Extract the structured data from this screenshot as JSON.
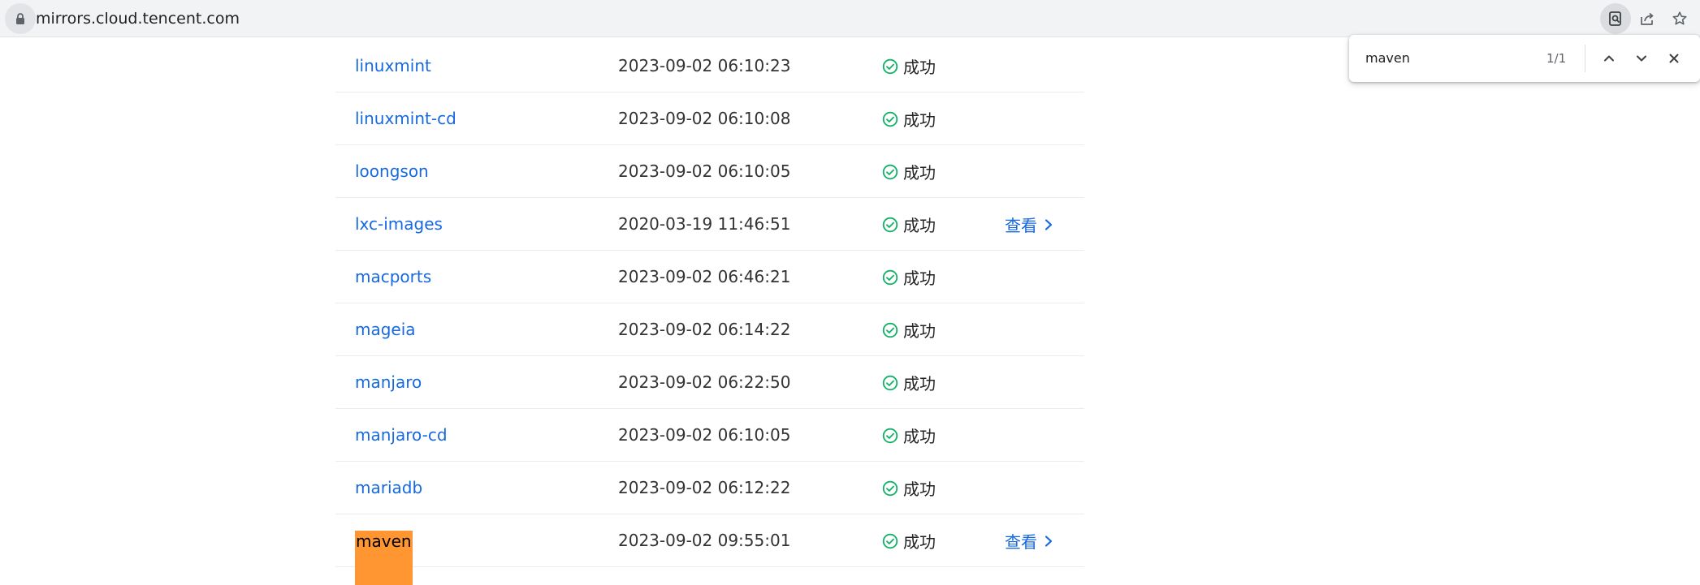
{
  "browser": {
    "url": "mirrors.cloud.tencent.com"
  },
  "find_bar": {
    "query": "maven",
    "count": "1/1"
  },
  "table": {
    "status_color": "#17b26a",
    "link_color": "#1769e0",
    "highlight_color": "#ff9632",
    "rows": [
      {
        "name": "linuxmint",
        "time": "2023-09-02 06:10:23",
        "status": "成功",
        "action": ""
      },
      {
        "name": "linuxmint-cd",
        "time": "2023-09-02 06:10:08",
        "status": "成功",
        "action": ""
      },
      {
        "name": "loongson",
        "time": "2023-09-02 06:10:05",
        "status": "成功",
        "action": ""
      },
      {
        "name": "lxc-images",
        "time": "2020-03-19 11:46:51",
        "status": "成功",
        "action": "查看"
      },
      {
        "name": "macports",
        "time": "2023-09-02 06:46:21",
        "status": "成功",
        "action": ""
      },
      {
        "name": "mageia",
        "time": "2023-09-02 06:14:22",
        "status": "成功",
        "action": ""
      },
      {
        "name": "manjaro",
        "time": "2023-09-02 06:22:50",
        "status": "成功",
        "action": ""
      },
      {
        "name": "manjaro-cd",
        "time": "2023-09-02 06:10:05",
        "status": "成功",
        "action": ""
      },
      {
        "name": "mariadb",
        "time": "2023-09-02 06:12:22",
        "status": "成功",
        "action": ""
      },
      {
        "name": "maven",
        "time": "2023-09-02 09:55:01",
        "status": "成功",
        "action": "查看",
        "highlighted": true
      }
    ]
  }
}
